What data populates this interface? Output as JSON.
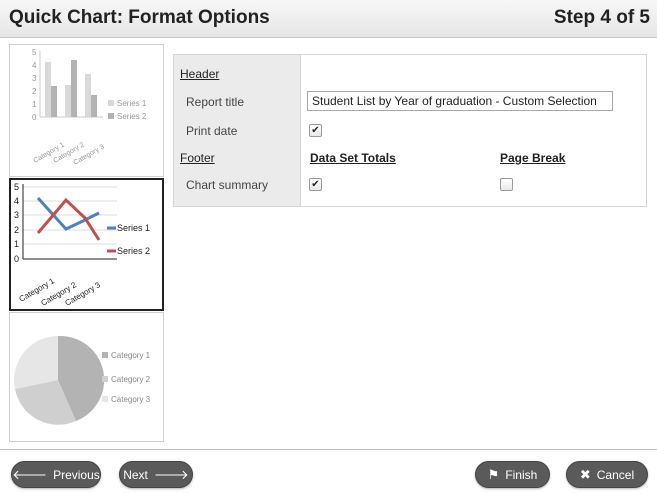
{
  "header": {
    "title": "Quick Chart: Format Options",
    "step": "Step 4 of 5"
  },
  "chart_options": [
    {
      "name": "bar-chart-option",
      "legend": [
        "Series 1",
        "Series 2"
      ],
      "y_ticks": [
        "5",
        "4",
        "3",
        "2",
        "1",
        "0"
      ],
      "categories": [
        "Category 1",
        "Category 2",
        "Category 3"
      ]
    },
    {
      "name": "line-chart-option",
      "legend": [
        "Series 1",
        "Series 2"
      ],
      "y_ticks": [
        "5",
        "4",
        "3",
        "2",
        "1",
        "0"
      ],
      "categories": [
        "Category 1",
        "Category 2",
        "Category 3"
      ]
    },
    {
      "name": "pie-chart-option",
      "legend": [
        "Category 1",
        "Category 2",
        "Category 3"
      ]
    }
  ],
  "form": {
    "header_label": "Header",
    "report_title_label": "Report title",
    "report_title_value": "Student List by Year of graduation - Custom Selection",
    "print_date_label": "Print date",
    "print_date_checked": true,
    "footer_label": "Footer",
    "data_set_totals_label": "Data Set Totals",
    "page_break_label": "Page Break",
    "chart_summary_label": "Chart summary",
    "chart_summary_checked": true,
    "page_break_checked": false
  },
  "buttons": {
    "previous": "Previous",
    "next": "Next",
    "finish": "Finish",
    "cancel": "Cancel"
  },
  "icons": {
    "previous": "arrow-left-icon",
    "next": "arrow-right-icon",
    "finish": "flag-icon",
    "cancel": "x-icon"
  },
  "colors": {
    "series1_line": "#4f81bd",
    "series2_line": "#c0504d",
    "button_bg": "#5a5a5a"
  }
}
